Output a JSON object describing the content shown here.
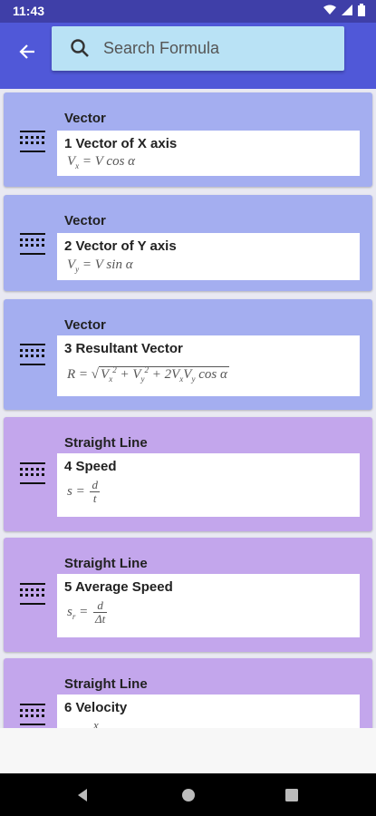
{
  "status": {
    "time": "11:43"
  },
  "search": {
    "placeholder": "Search Formula"
  },
  "formulas": [
    {
      "category": "Vector",
      "name": "1 Vector of X axis",
      "formula": "V_x = V cos α"
    },
    {
      "category": "Vector",
      "name": "2 Vector of Y axis",
      "formula": "V_y = V sin α"
    },
    {
      "category": "Vector",
      "name": "3 Resultant Vector",
      "formula": "R = √(V_x² + V_y² + 2V_xV_y cos α)"
    },
    {
      "category": "Straight Line",
      "name": "4 Speed",
      "formula": "s = d / t"
    },
    {
      "category": "Straight Line",
      "name": "5 Average Speed",
      "formula": "s_r = d / Δt"
    },
    {
      "category": "Straight Line",
      "name": "6 Velocity",
      "formula": "x"
    }
  ],
  "colors": {
    "appbar": "#5058d8",
    "vector_card": "#a4aef0",
    "line_card": "#c3a6ec"
  },
  "icons": {
    "back": "arrow-left-icon",
    "search": "search-icon",
    "menu": "list-icon"
  }
}
